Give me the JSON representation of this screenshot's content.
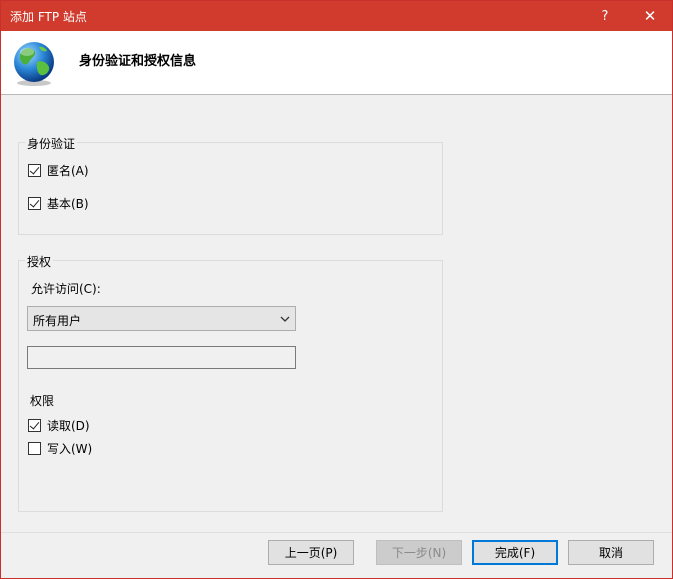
{
  "window": {
    "title": "添加 FTP 站点",
    "help_glyph": "?",
    "close_glyph": "✕"
  },
  "header": {
    "title": "身份验证和授权信息",
    "icon": "globe-icon"
  },
  "auth_group": {
    "label": "身份验证",
    "anonymous_label": "匿名(A)",
    "anonymous_checked": true,
    "basic_label": "基本(B)",
    "basic_checked": true
  },
  "authz_group": {
    "label": "授权",
    "allow_access_label": "允许访问(C):",
    "allow_access_selected": "所有用户",
    "user_input_value": "",
    "permissions_label": "权限",
    "read_label": "读取(D)",
    "read_checked": true,
    "write_label": "写入(W)",
    "write_checked": false
  },
  "footer": {
    "prev_label": "上一页(P)",
    "next_label": "下一步(N)",
    "finish_label": "完成(F)",
    "cancel_label": "取消"
  },
  "colors": {
    "titlebar": "#d03b2e",
    "accent": "#0078d7"
  }
}
